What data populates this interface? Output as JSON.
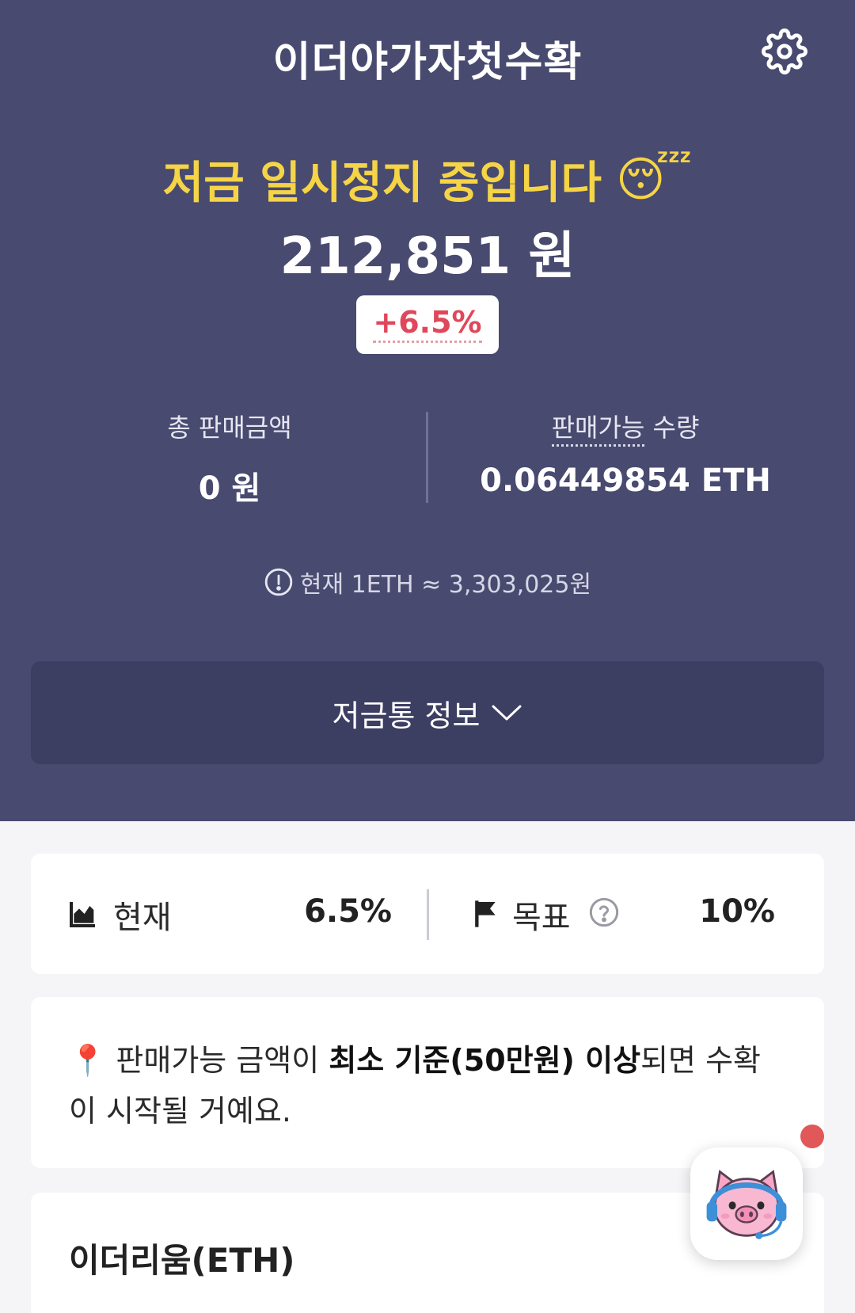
{
  "header": {
    "title": "이더야가자첫수확",
    "settings_icon": "gear-icon"
  },
  "summary": {
    "status_text": "저금 일시정지 중입니다",
    "status_emoji": "😴",
    "amount": "212,851 원",
    "change_badge": "+6.5%",
    "total_sales_label": "총 판매금액",
    "total_sales_value": "0 원",
    "sellable_label": "판매가능 수량",
    "sellable_value": "0.06449854 ETH",
    "rate_text": "현재 1ETH ≈ 3,303,025원"
  },
  "piggy_info_button": {
    "label": "저금통 정보"
  },
  "progress": {
    "current_label": "현재",
    "current_value": "6.5%",
    "target_label": "목표",
    "target_value": "10%"
  },
  "notice": {
    "pin_emoji": "📍",
    "text_before": "판매가능 금액이 ",
    "text_bold": "최소 기준(50만원) 이상",
    "text_after": "되면 수확이 시작될 거예요."
  },
  "asset": {
    "title": "이더리움(ETH)"
  },
  "colors": {
    "hero_bg": "#484a70",
    "status_yellow": "#f5d446",
    "badge_red": "#e0475a",
    "notification_dot": "#e05858"
  }
}
